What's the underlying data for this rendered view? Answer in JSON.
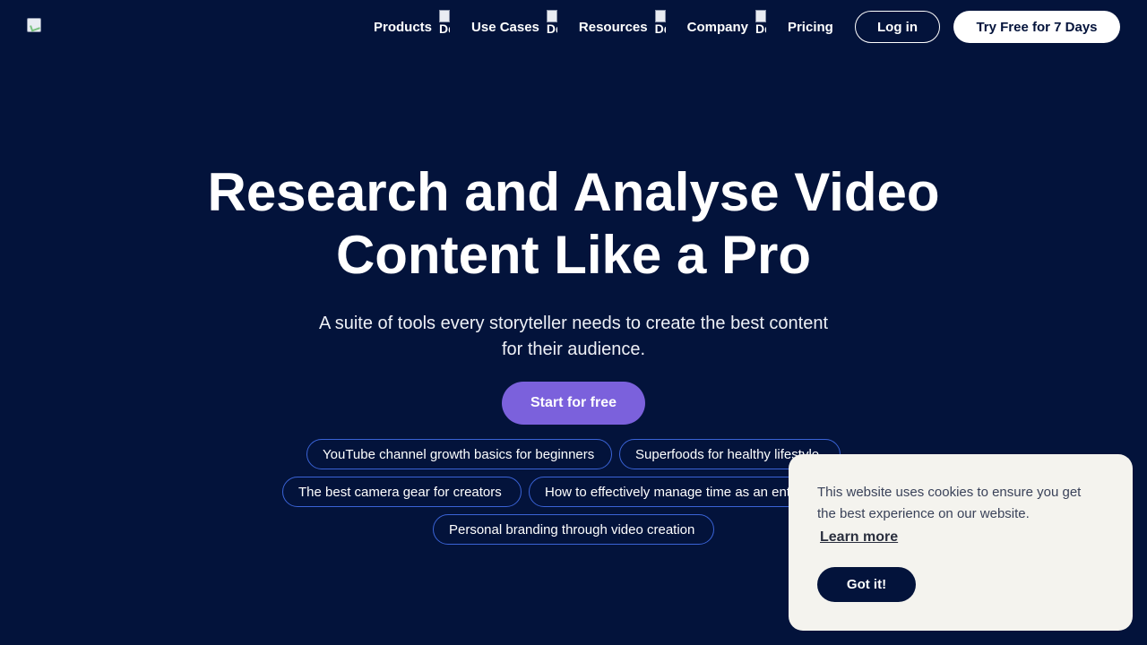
{
  "header": {
    "logo": "site-logo",
    "nav": [
      {
        "label": "Products",
        "icon_alt": "Dd ar"
      },
      {
        "label": "Use Cases",
        "icon_alt": "Dd ar"
      },
      {
        "label": "Resources",
        "icon_alt": "Dd ar"
      },
      {
        "label": "Company",
        "icon_alt": "Dd ar"
      },
      {
        "label": "Pricing"
      }
    ],
    "login_label": "Log in",
    "trial_label": "Try Free for 7 Days"
  },
  "hero": {
    "title_line1": "Research and Analyse Video",
    "title_line2": "Content Like a Pro",
    "subtitle_line1": "A suite of tools every storyteller needs to create the best content",
    "subtitle_line2": "for their audience.",
    "cta_label": "Start for free"
  },
  "chips": [
    "YouTube channel growth basics for beginners",
    "Superfoods for healthy lifestyle",
    "The best camera gear for creators",
    "How to effectively manage time as an entrepreneur",
    "Personal branding through video creation"
  ],
  "cookie": {
    "text_line1": "This website uses cookies to ensure you get",
    "text_line2": "the best experience on our website.",
    "learn_more": "Learn more",
    "accept": "Got it!"
  },
  "colors": {
    "background": "#03133b",
    "accent": "#7b61dc",
    "chip_border": "#3a63d6",
    "cookie_bg": "#f4f3ee"
  }
}
